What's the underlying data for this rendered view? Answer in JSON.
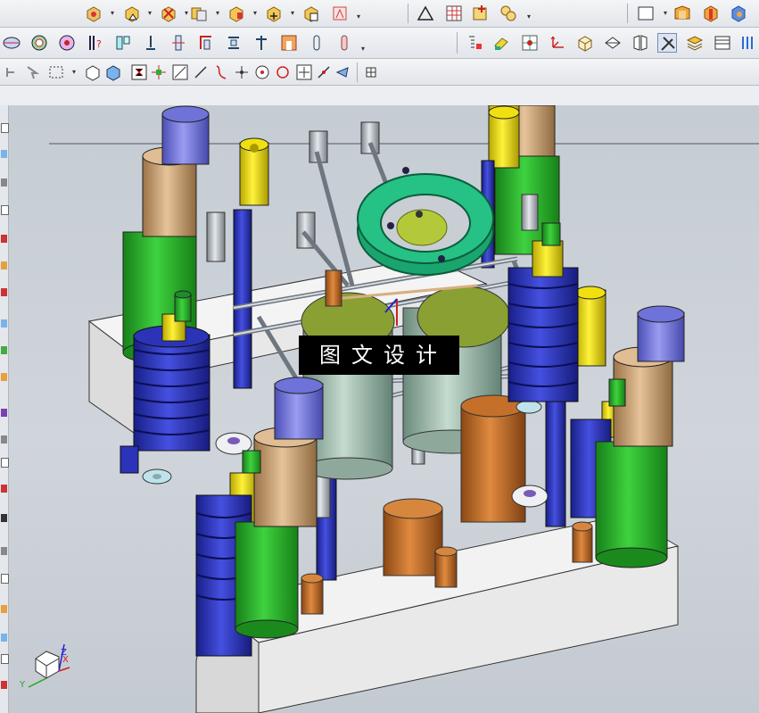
{
  "toolbar": {
    "row1_icons": [
      "view-point-icon",
      "component-icon",
      "remove-component-icon",
      "replace-icon",
      "assembly-constraints-icon",
      "duplicate-icon",
      "explode-view-icon",
      "more-icon",
      "triangle-icon",
      "spreadsheet-icon",
      "add-component-icon",
      "assembly-navigator-icon",
      "box-select-icon",
      "shell-icon",
      "feature-icon",
      "cube-icon"
    ],
    "row2_icons": [
      "mirror-icon",
      "eye-icon",
      "pattern-icon",
      "interference-icon",
      "clearance-icon",
      "move-icon",
      "align-icon",
      "touch-icon",
      "concentric-icon",
      "parallel-icon",
      "perpendicular-icon",
      "fit-icon",
      "bar-icon",
      "stack-icon",
      "part-navigator-icon",
      "lock-icon",
      "csys-icon",
      "box-icon",
      "section-icon",
      "frame-icon",
      "tools-icon",
      "layers-icon",
      "sheet-icon",
      "drop-icon"
    ],
    "row3_icons": [
      "snap-icon",
      "pointer-icon",
      "selection-box-icon",
      "view-cube-icon",
      "wireframe-icon",
      "shaded-icon",
      "fit-all-icon",
      "zoom-icon",
      "line-icon",
      "diagonal-icon",
      "curve-icon",
      "arrow-up-icon",
      "circle-point-icon",
      "intersection-icon",
      "plus-icon",
      "slash-icon",
      "rotate-icon",
      "grid-icon"
    ]
  },
  "viewport": {
    "watermark_text": "图文设计",
    "triad": {
      "x_label": "X",
      "y_label": "Y",
      "z_label": "Z"
    }
  },
  "colors": {
    "green": "#2bb52b",
    "tan": "#d6b080",
    "blue": "#2b33b8",
    "yellow": "#f0e010",
    "teal_ring": "#1aa56f",
    "base": "#ededed",
    "dark_green": "#1e8c2c",
    "lavender": "#6f72d8",
    "cylinder_olive": "#8aa033",
    "brown": "#c4702a",
    "gray_rod": "#b8bec4"
  }
}
